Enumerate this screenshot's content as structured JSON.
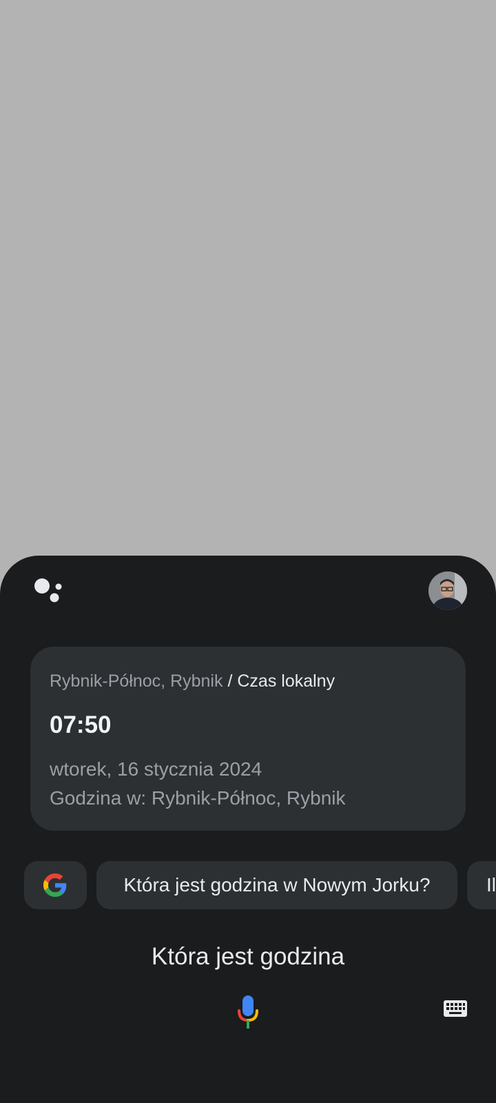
{
  "card": {
    "location": "Rybnik-Północ, Rybnik",
    "separator": "/",
    "label": "Czas lokalny",
    "time": "07:50",
    "date": "wtorek, 16 stycznia 2024",
    "place": "Godzina w: Rybnik-Północ, Rybnik"
  },
  "chips": {
    "google_icon": "google-g-icon",
    "suggestion": "Która jest godzina w Nowym Jorku?",
    "partial": "Il"
  },
  "query": "Która jest godzina",
  "icons": {
    "assistant": "assistant-dots-icon",
    "avatar": "user-avatar",
    "mic": "microphone-icon",
    "keyboard": "keyboard-icon"
  },
  "colors": {
    "sheet": "#1a1c1e",
    "card": "#2d3033",
    "blue": "#4285f4",
    "red": "#ea4335",
    "yellow": "#fbbc05",
    "green": "#34a853"
  }
}
